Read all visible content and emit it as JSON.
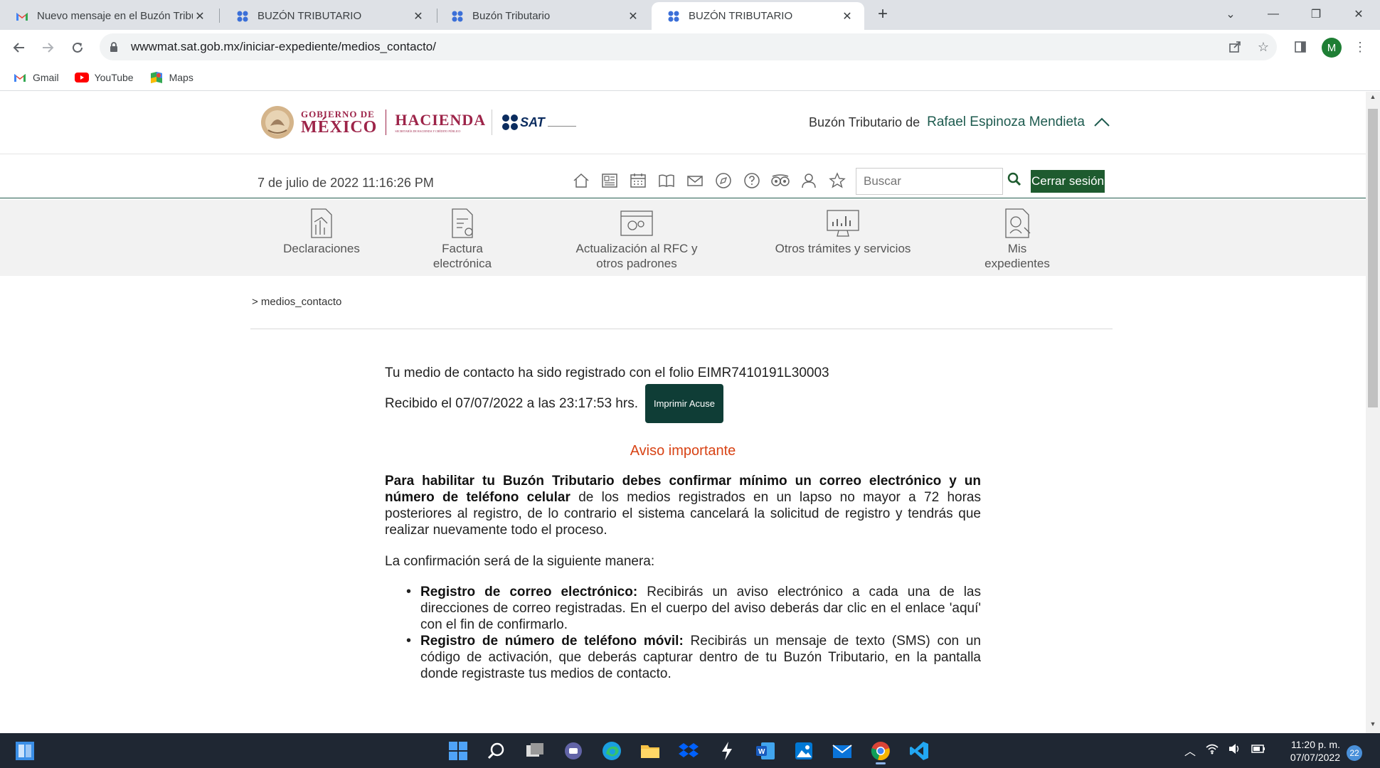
{
  "browser": {
    "tabs": [
      {
        "title": "Nuevo mensaje en el Buzón Tributario",
        "icon": "gmail-icon",
        "active": false
      },
      {
        "title": "BUZÓN TRIBUTARIO",
        "icon": "sat-icon",
        "active": false
      },
      {
        "title": "Buzón Tributario",
        "icon": "sat-icon",
        "active": false
      },
      {
        "title": "BUZÓN TRIBUTARIO",
        "icon": "sat-icon",
        "active": true
      }
    ],
    "url": "wwwmat.sat.gob.mx/iniciar-expediente/medios_contacto/",
    "profile_initial": "M",
    "bookmarks": [
      {
        "label": "Gmail",
        "icon": "gmail-icon"
      },
      {
        "label": "YouTube",
        "icon": "youtube-icon"
      },
      {
        "label": "Maps",
        "icon": "maps-icon"
      }
    ]
  },
  "header": {
    "gob_line1": "GOBIERNO DE",
    "gob_line2": "MÉXICO",
    "hacienda": "HACIENDA",
    "hacienda_sub": "SECRETARÍA DE HACIENDA Y CRÉDITO PÚBLICO",
    "sat": "SAT",
    "buzon_label": "Buzón Tributario de",
    "user_name": "Rafael Espinoza Mendieta"
  },
  "subbar": {
    "datetime": "7 de julio de 2022 11:16:26 PM",
    "search_placeholder": "Buscar",
    "logout": "Cerrar sesión"
  },
  "menu": {
    "items": [
      {
        "line1": "Declaraciones",
        "line2": ""
      },
      {
        "line1": "Factura",
        "line2": "electrónica"
      },
      {
        "line1": "Actualización al RFC y",
        "line2": "otros padrones"
      },
      {
        "line1": "Otros trámites y servicios",
        "line2": ""
      },
      {
        "line1": "Mis",
        "line2": "expedientes"
      }
    ]
  },
  "breadcrumb": "> medios_contacto",
  "content": {
    "folio_line": "Tu medio de contacto ha sido registrado con el folio EIMR7410191L30003",
    "recibido": "Recibido el 07/07/2022 a las 23:17:53 hrs.",
    "print_button": "Imprimir Acuse",
    "aviso_title": "Aviso importante",
    "aviso_bold": "Para habilitar tu Buzón Tributario debes confirmar mínimo un correo electrónico y un número de teléfono celular",
    "aviso_rest": " de los medios registrados en un lapso no mayor a 72 horas posteriores al registro, de lo contrario el sistema cancelará la solicitud de registro y tendrás que realizar nuevamente todo el proceso.",
    "confirm_intro": "La confirmación será de la siguiente manera:",
    "list": [
      {
        "bold": "Registro de correo electrónico:",
        "text": " Recibirás un aviso electrónico a cada una de las direcciones de correo registradas. En el cuerpo del aviso deberás dar clic en el enlace 'aquí' con el fin de confirmarlo."
      },
      {
        "bold": "Registro de número de teléfono móvil:",
        "text": " Recibirás un mensaje de texto (SMS) con un código de activación, que deberás capturar dentro de tu Buzón Tributario, en la pantalla donde registraste tus medios de contacto."
      }
    ]
  },
  "taskbar": {
    "time": "11:20 p. m.",
    "date": "07/07/2022",
    "badge": "22"
  }
}
